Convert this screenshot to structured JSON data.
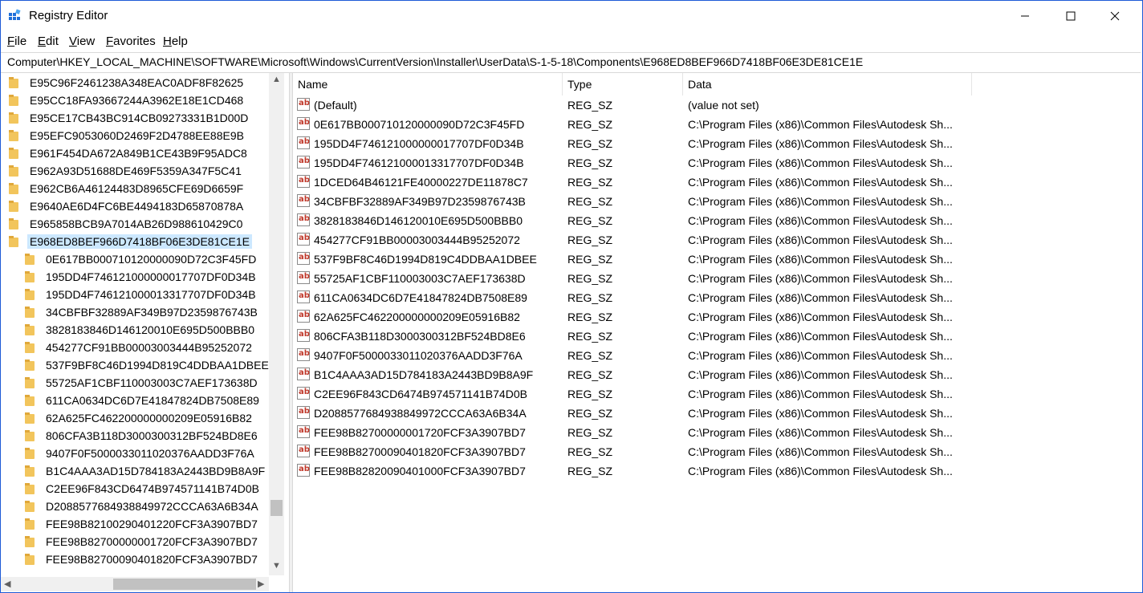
{
  "window": {
    "title": "Registry Editor"
  },
  "menu": [
    {
      "label": "File",
      "u": "F",
      "rest": "ile"
    },
    {
      "label": "Edit",
      "u": "E",
      "rest": "dit"
    },
    {
      "label": "View",
      "u": "V",
      "rest": "iew"
    },
    {
      "label": "Favorites",
      "u": "F",
      "rest": "avorites"
    },
    {
      "label": "Help",
      "u": "H",
      "rest": "elp"
    }
  ],
  "address": "Computer\\HKEY_LOCAL_MACHINE\\SOFTWARE\\Microsoft\\Windows\\CurrentVersion\\Installer\\UserData\\S-1-5-18\\Components\\E968ED8BEF966D7418BF06E3DE81CE1E",
  "tree": [
    {
      "label": "E95C96F2461238A348EAC0ADF8F82625",
      "level": 0
    },
    {
      "label": "E95CC18FA93667244A3962E18E1CD468",
      "level": 0
    },
    {
      "label": "E95CE17CB43BC914CB09273331B1D00D",
      "level": 0
    },
    {
      "label": "E95EFC9053060D2469F2D4788EE88E9B",
      "level": 0
    },
    {
      "label": "E961F454DA672A849B1CE43B9F95ADC8",
      "level": 0
    },
    {
      "label": "E962A93D51688DE469F5359A347F5C41",
      "level": 0
    },
    {
      "label": "E962CB6A46124483D8965CFE69D6659F",
      "level": 0
    },
    {
      "label": "E9640AE6D4FC6BE4494183D65870878A",
      "level": 0
    },
    {
      "label": "E965858BCB9A7014AB26D988610429C0",
      "level": 0
    },
    {
      "label": "E968ED8BEF966D7418BF06E3DE81CE1E",
      "level": 0,
      "selected": true
    },
    {
      "label": "0E617BB000710120000090D72C3F45FD",
      "level": 1
    },
    {
      "label": "195DD4F746121000000017707DF0D34B",
      "level": 1
    },
    {
      "label": "195DD4F746121000013317707DF0D34B",
      "level": 1
    },
    {
      "label": "34CBFBF32889AF349B97D2359876743B",
      "level": 1
    },
    {
      "label": "3828183846D146120010E695D500BBB0",
      "level": 1
    },
    {
      "label": "454277CF91BB00003003444B95252072",
      "level": 1
    },
    {
      "label": "537F9BF8C46D1994D819C4DDBAA1DBEE",
      "level": 1
    },
    {
      "label": "55725AF1CBF110003003C7AEF173638D",
      "level": 1
    },
    {
      "label": "611CA0634DC6D7E41847824DB7508E89",
      "level": 1
    },
    {
      "label": "62A625FC462200000000209E05916B82",
      "level": 1
    },
    {
      "label": "806CFA3B118D3000300312BF524BD8E6",
      "level": 1
    },
    {
      "label": "9407F0F5000033011020376AADD3F76A",
      "level": 1
    },
    {
      "label": "B1C4AAA3AD15D784183A2443BD9B8A9F",
      "level": 1
    },
    {
      "label": "C2EE96F843CD6474B974571141B74D0B",
      "level": 1
    },
    {
      "label": "D208857768493884997​2CCCA63A6B34A",
      "level": 1
    },
    {
      "label": "FEE98B82100290401220FCF3A3907BD7",
      "level": 1
    },
    {
      "label": "FEE98B82700000001720FCF3A3907BD7",
      "level": 1
    },
    {
      "label": "FEE98B82700090401820FCF3A3907BD7",
      "level": 1
    }
  ],
  "columns": {
    "name": "Name",
    "type": "Type",
    "data": "Data"
  },
  "values": [
    {
      "name": "(Default)",
      "type": "REG_SZ",
      "data": "(value not set)"
    },
    {
      "name": "0E617BB000710120000090D72C3F45FD",
      "type": "REG_SZ",
      "data": "C:\\Program Files (x86)\\Common Files\\Autodesk Sh..."
    },
    {
      "name": "195DD4F746121000000017707DF0D34B",
      "type": "REG_SZ",
      "data": "C:\\Program Files (x86)\\Common Files\\Autodesk Sh..."
    },
    {
      "name": "195DD4F746121000013317707DF0D34B",
      "type": "REG_SZ",
      "data": "C:\\Program Files (x86)\\Common Files\\Autodesk Sh..."
    },
    {
      "name": "1DCED64B46121FE40000227DE11878C7",
      "type": "REG_SZ",
      "data": "C:\\Program Files (x86)\\Common Files\\Autodesk Sh..."
    },
    {
      "name": "34CBFBF32889AF349B97D2359876743B",
      "type": "REG_SZ",
      "data": "C:\\Program Files (x86)\\Common Files\\Autodesk Sh..."
    },
    {
      "name": "3828183846D146120010E695D500BBB0",
      "type": "REG_SZ",
      "data": "C:\\Program Files (x86)\\Common Files\\Autodesk Sh..."
    },
    {
      "name": "454277CF91BB00003003444B95252072",
      "type": "REG_SZ",
      "data": "C:\\Program Files (x86)\\Common Files\\Autodesk Sh..."
    },
    {
      "name": "537F9BF8C46D1994D819C4DDBAA1DBEE",
      "type": "REG_SZ",
      "data": "C:\\Program Files (x86)\\Common Files\\Autodesk Sh..."
    },
    {
      "name": "55725AF1CBF110003003C7AEF173638D",
      "type": "REG_SZ",
      "data": "C:\\Program Files (x86)\\Common Files\\Autodesk Sh..."
    },
    {
      "name": "611CA0634DC6D7E41847824DB7508E89",
      "type": "REG_SZ",
      "data": "C:\\Program Files (x86)\\Common Files\\Autodesk Sh..."
    },
    {
      "name": "62A625FC462200000000209E05916B82",
      "type": "REG_SZ",
      "data": "C:\\Program Files (x86)\\Common Files\\Autodesk Sh..."
    },
    {
      "name": "806CFA3B118D3000300312BF524BD8E6",
      "type": "REG_SZ",
      "data": "C:\\Program Files (x86)\\Common Files\\Autodesk Sh..."
    },
    {
      "name": "9407F0F5000033011020376AADD3F76A",
      "type": "REG_SZ",
      "data": "C:\\Program Files (x86)\\Common Files\\Autodesk Sh..."
    },
    {
      "name": "B1C4AAA3AD15D784183A2443BD9B8A9F",
      "type": "REG_SZ",
      "data": "C:\\Program Files (x86)\\Common Files\\Autodesk Sh..."
    },
    {
      "name": "C2EE96F843CD6474B974571141B74D0B",
      "type": "REG_SZ",
      "data": "C:\\Program Files (x86)\\Common Files\\Autodesk Sh..."
    },
    {
      "name": "D2088577684938849972CCCA63A6B34A",
      "type": "REG_SZ",
      "data": "C:\\Program Files (x86)\\Common Files\\Autodesk Sh..."
    },
    {
      "name": "FEE98B82700000001720FCF3A3907BD7",
      "type": "REG_SZ",
      "data": "C:\\Program Files (x86)\\Common Files\\Autodesk Sh..."
    },
    {
      "name": "FEE98B82700090401820FCF3A3907BD7",
      "type": "REG_SZ",
      "data": "C:\\Program Files (x86)\\Common Files\\Autodesk Sh..."
    },
    {
      "name": "FEE98B82820090401000FCF3A3907BD7",
      "type": "REG_SZ",
      "data": "C:\\Program Files (x86)\\Common Files\\Autodesk Sh..."
    }
  ],
  "icons": {
    "app": "registry-editor-icon",
    "folder": "folder-icon",
    "string_value": "ab-string-value-icon"
  },
  "colors": {
    "window_border": "#1e5bd6",
    "selection": "#cce8ff",
    "folder": "#f2c55c",
    "ab_icon_text": "#c0392b"
  }
}
